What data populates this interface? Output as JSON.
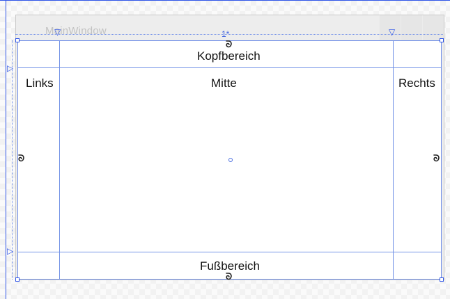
{
  "window": {
    "title": "MainWindow"
  },
  "designer": {
    "column_width_label": "1*"
  },
  "grid": {
    "header": "Kopfbereich",
    "left": "Links",
    "center": "Mitte",
    "right": "Rechts",
    "footer": "Fußbereich"
  },
  "colors": {
    "selection": "#2f55e8",
    "grid_line": "#7393e6"
  }
}
